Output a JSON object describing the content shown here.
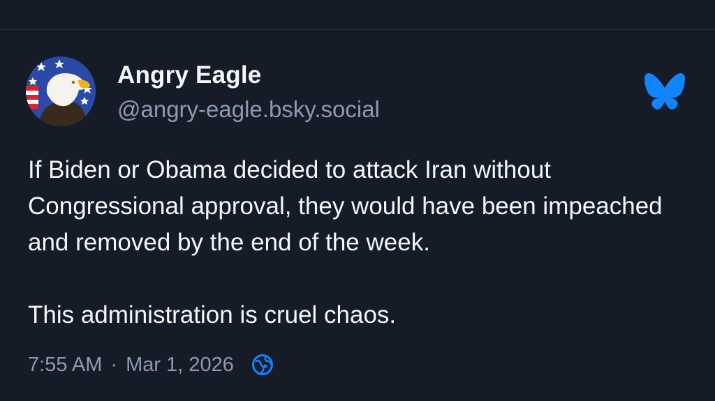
{
  "post": {
    "author": {
      "display_name": "Angry Eagle",
      "handle": "@angry-eagle.bsky.social"
    },
    "text": "If Biden or Obama decided to attack Iran without Congressional approval, they would have been impeached and removed by the end of the week.\n\nThis administration is cruel chaos.",
    "time": "7:55 AM",
    "separator": "·",
    "date": "Mar 1, 2026",
    "icons": {
      "avatar": "bald-eagle-flag-avatar",
      "brand": "bluesky-butterfly-icon",
      "visibility": "globe-icon"
    }
  },
  "colors": {
    "background": "#151c27",
    "text": "#f4f6f9",
    "muted": "#8c9bb0",
    "bluesky_blue": "#1185fe"
  }
}
